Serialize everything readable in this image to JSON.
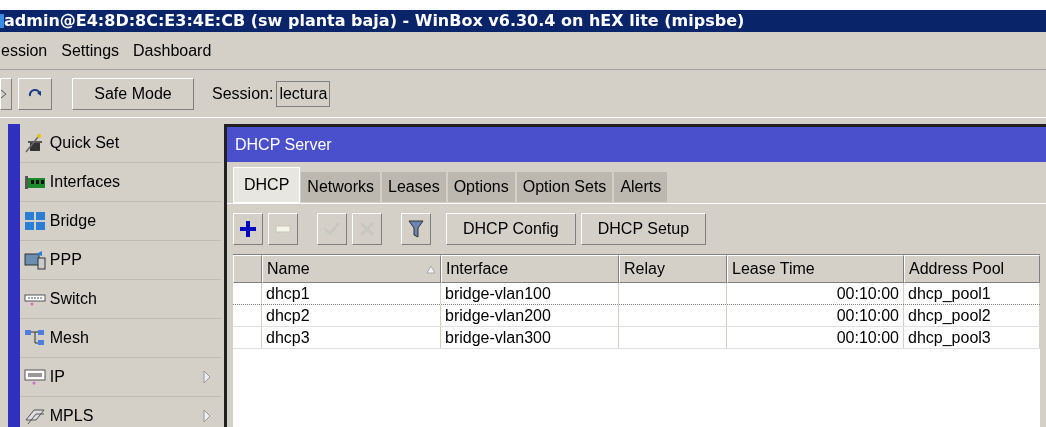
{
  "window": {
    "title": "admin@E4:8D:8C:E3:4E:CB (sw planta baja) - WinBox v6.30.4 on hEX lite (mipsbe)"
  },
  "menu": [
    "ession",
    "Settings",
    "Dashboard"
  ],
  "toolbar": {
    "safe_mode": "Safe Mode",
    "session_label": "Session:",
    "session_value": "lectura"
  },
  "sidebar": {
    "items": [
      {
        "label": "Quick Set",
        "kind": "wand",
        "submenu": false
      },
      {
        "label": "Interfaces",
        "kind": "card",
        "submenu": false
      },
      {
        "label": "Bridge",
        "kind": "bridge",
        "submenu": false
      },
      {
        "label": "PPP",
        "kind": "ppp",
        "submenu": false
      },
      {
        "label": "Switch",
        "kind": "switch",
        "submenu": false
      },
      {
        "label": "Mesh",
        "kind": "mesh",
        "submenu": false
      },
      {
        "label": "IP",
        "kind": "ip",
        "submenu": true
      },
      {
        "label": "MPLS",
        "kind": "tag",
        "submenu": true
      }
    ]
  },
  "dhcp_window": {
    "title": "DHCP Server",
    "tabs": [
      {
        "label": "DHCP",
        "selected": true
      },
      {
        "label": "Networks",
        "selected": false
      },
      {
        "label": "Leases",
        "selected": false
      },
      {
        "label": "Options",
        "selected": false
      },
      {
        "label": "Option Sets",
        "selected": false
      },
      {
        "label": "Alerts",
        "selected": false
      }
    ],
    "tools": [
      {
        "kind": "add",
        "disabled": false
      },
      {
        "kind": "remove",
        "disabled": true
      },
      {
        "kind": "enable",
        "disabled": true
      },
      {
        "kind": "disable",
        "disabled": true
      },
      {
        "kind": "filter",
        "disabled": false
      }
    ],
    "buttons": [
      "DHCP Config",
      "DHCP Setup"
    ],
    "table": {
      "columns": [
        {
          "label": "Name",
          "sorted": true
        },
        {
          "label": "Interface",
          "sorted": false
        },
        {
          "label": "Relay",
          "sorted": false
        },
        {
          "label": "Lease Time",
          "sorted": false
        },
        {
          "label": "Address Pool",
          "sorted": false
        }
      ],
      "rows": [
        {
          "selected": true,
          "cells": [
            "dhcp1",
            "bridge-vlan100",
            "",
            "00:10:00",
            "dhcp_pool1"
          ]
        },
        {
          "selected": false,
          "cells": [
            "dhcp2",
            "bridge-vlan200",
            "",
            "00:10:00",
            "dhcp_pool2"
          ]
        },
        {
          "selected": false,
          "cells": [
            "dhcp3",
            "bridge-vlan300",
            "",
            "00:10:00",
            "dhcp_pool3"
          ]
        }
      ]
    }
  }
}
